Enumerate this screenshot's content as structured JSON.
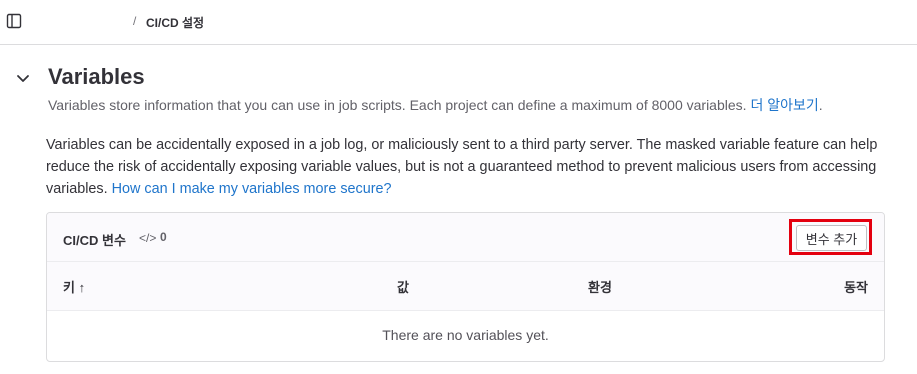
{
  "breadcrumb": {
    "separator": "/",
    "current": "CI/CD 설정"
  },
  "section": {
    "title": "Variables",
    "subtitle": "Variables store information that you can use in job scripts. Each project can define a maximum of 8000 variables.",
    "learn_more": "더 알아보기",
    "subtitle_end": ".",
    "description": "Variables can be accidentally exposed in a job log, or maliciously sent to a third party server. The masked variable feature can help reduce the risk of accidentally exposing variable values, but is not a guaranteed method to prevent malicious users from accessing variables.",
    "secure_link": "How can I make my variables more secure?"
  },
  "card": {
    "title": "CI/CD 변수",
    "code_icon": "</>",
    "count": "0",
    "add_button": "변수 추가"
  },
  "table": {
    "headers": {
      "key": "키 ↑",
      "value": "값",
      "environment": "환경",
      "actions": "동작"
    },
    "empty_message": "There are no variables yet."
  },
  "icons": {
    "sidebar_toggle": "sidebar-toggle-icon",
    "collapse": "chevron-down-icon",
    "code": "code-icon"
  },
  "colors": {
    "link": "#1f75cb",
    "highlight": "#e4000f"
  }
}
